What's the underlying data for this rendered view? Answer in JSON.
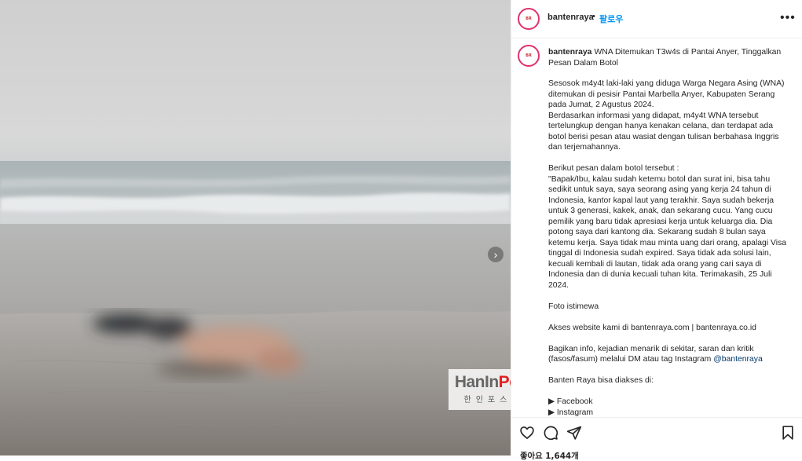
{
  "post": {
    "username": "bantenraya",
    "separator": "•",
    "follow_label": "팔로우",
    "more_icon": "more-horizontal-icon"
  },
  "photo": {
    "watermark_title_a": "HanIn",
    "watermark_title_b": "Post",
    "watermark_subtitle": "한인포스트",
    "next_icon": "chevron-right-icon"
  },
  "caption": {
    "username": "bantenraya",
    "title": "WNA Ditemukan T3w4s di Pantai Anyer, Tinggalkan Pesan Dalam Botol",
    "body_1": "Sesosok m4y4t laki-laki yang diduga Warga Negara Asing (WNA) ditemukan di pesisir Pantai Marbella Anyer, Kabupaten Serang pada Jumat, 2 Agustus 2024.\nBerdasarkan informasi yang didapat, m4y4t WNA tersebut tertelungkup dengan hanya kenakan celana, dan terdapat ada botol berisi pesan atau wasiat dengan tulisan berbahasa Inggris dan terjemahannya.\n\nBerikut pesan dalam botol tersebut :\n\"Bapak/Ibu, kalau sudah ketemu botol dan surat ini, bisa tahu sedikit untuk saya, saya seorang asing yang kerja 24 tahun di Indonesia, kantor kapal laut yang terakhir. Saya sudah bekerja untuk 3 generasi, kakek, anak, dan sekarang cucu. Yang cucu pemilik yang baru tidak apresiasi kerja untuk keluarga dia. Dia potong saya dari kantong dia. Sekarang sudah 8 bulan saya ketemu kerja. Saya tidak mau minta uang dari orang, apalagi Visa tinggal di Indonesia sudah expired. Saya tidak ada solusi lain, kecuali kembali di lautan, tidak ada orang yang cari saya di Indonesia dan di dunia kecuali tuhan kita. Terimakasih, 25 Juli 2024.\n\nFoto istimewa\n\nAkses website kami di bantenraya.com | bantenraya.co.id\n\nBagikan info, kejadian menarik di sekitar, saran dan kritik (fasos/fasum) melalui DM atau tag Instagram ",
    "mention": "@bantenraya",
    "body_2": "\n\nBanten Raya bisa diakses di:\n\n▶ Facebook\n▶ Instagram"
  },
  "actions": {
    "like_icon": "heart-icon",
    "comment_icon": "comment-icon",
    "share_icon": "share-icon",
    "save_icon": "bookmark-icon",
    "likes_text": "좋아요 1,644개"
  }
}
